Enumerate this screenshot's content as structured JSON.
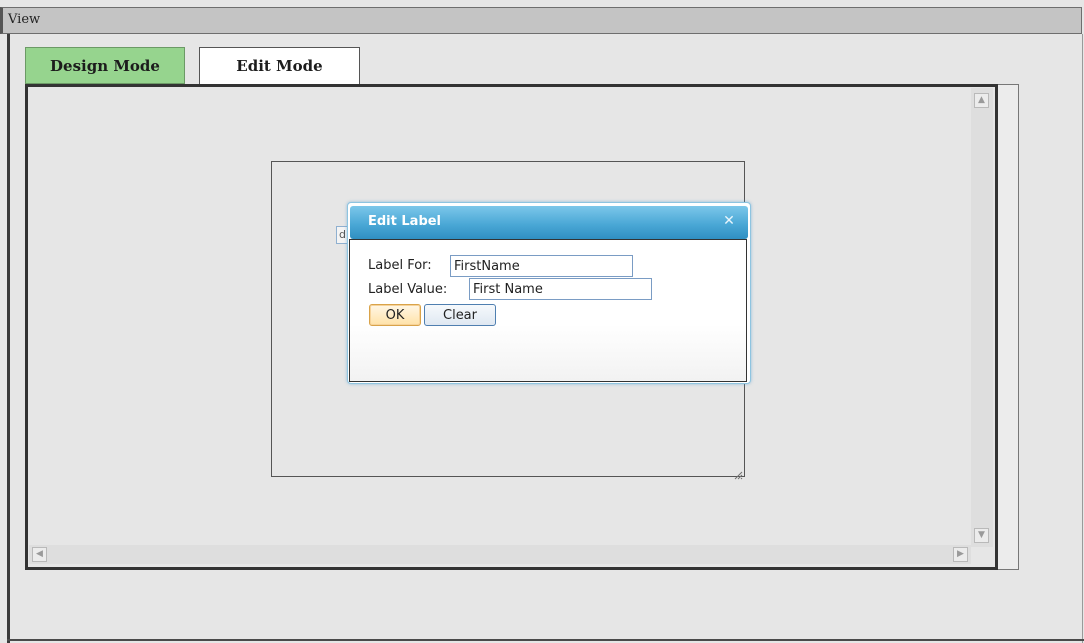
{
  "header": {
    "title": "View"
  },
  "tabs": [
    {
      "label": "Design Mode",
      "active": true
    },
    {
      "label": "Edit Mode",
      "active": false
    }
  ],
  "canvas": {
    "dropped_label_text": "d"
  },
  "dialog": {
    "title": "Edit Label",
    "close_icon": "close-icon",
    "label_for": {
      "label": "Label For:",
      "value": "FirstName"
    },
    "label_value": {
      "label": "Label Value:",
      "value": "First Name"
    },
    "ok_label": "OK",
    "clear_label": "Clear"
  },
  "colors": {
    "active_tab": "#96d48e",
    "dialog_title_bar": "#4ba8d6",
    "ok_button_border": "#d9a34a"
  }
}
